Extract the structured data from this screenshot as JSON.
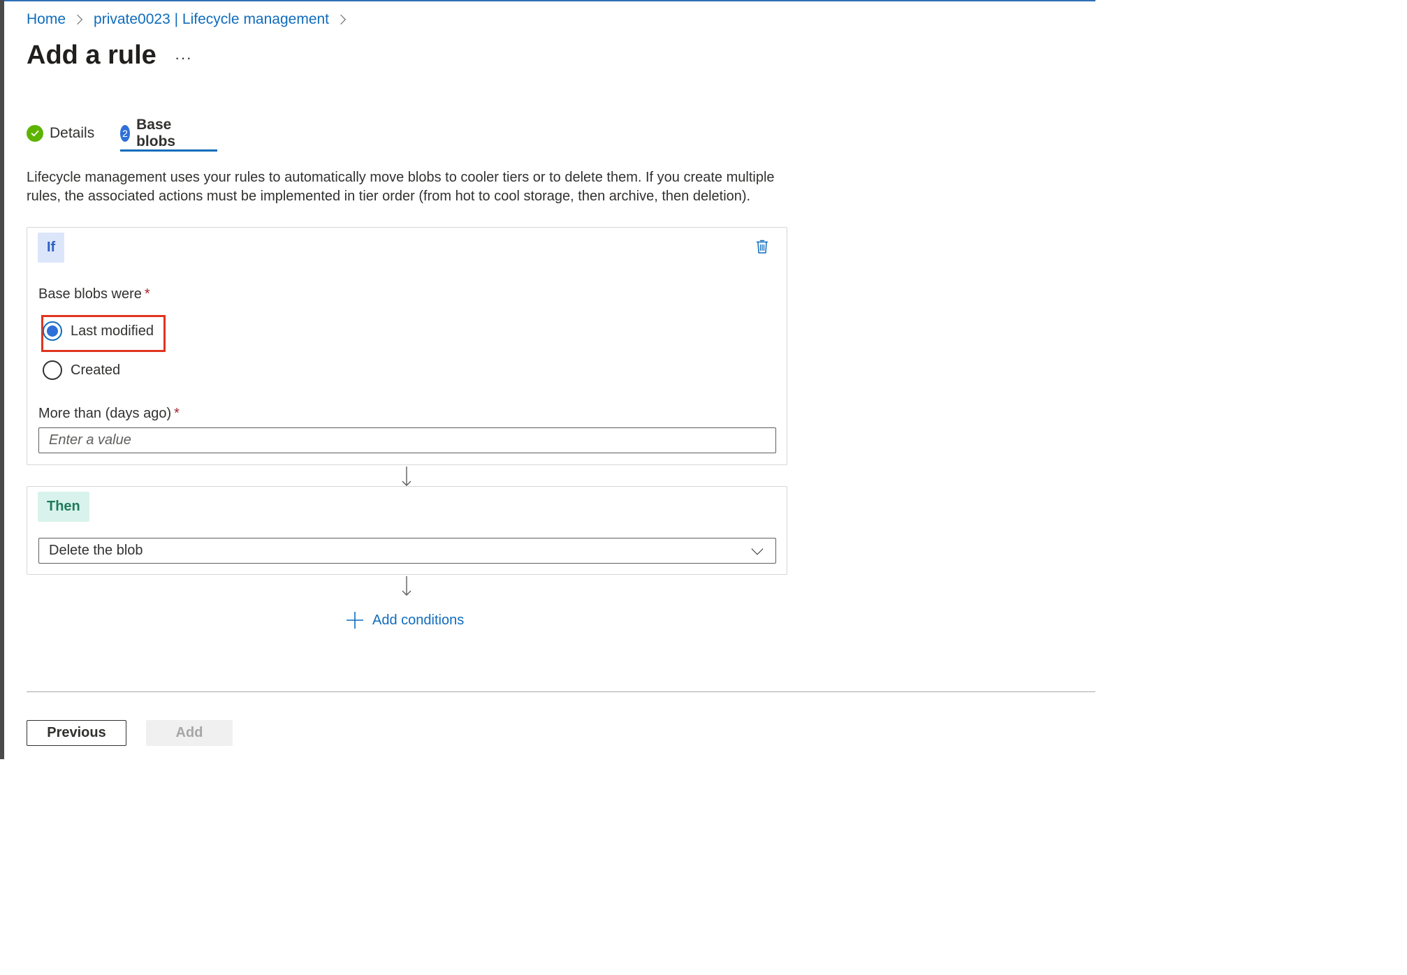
{
  "breadcrumb": {
    "home": "Home",
    "parent": "private0023 | Lifecycle management"
  },
  "page": {
    "title": "Add a rule",
    "more": "···"
  },
  "tabs": [
    {
      "label": "Details",
      "state": "completed",
      "badge": ""
    },
    {
      "label": "Base blobs",
      "state": "active",
      "badge": "2"
    }
  ],
  "description": "Lifecycle management uses your rules to automatically move blobs to cooler tiers or to delete them. If you create multiple rules, the associated actions must be implemented in tier order (from hot to cool storage, then archive, then deletion).",
  "if_block": {
    "pill": "If",
    "base_blobs_label": "Base blobs were",
    "required_mark": "*",
    "options": [
      {
        "label": "Last modified",
        "selected": true
      },
      {
        "label": "Created",
        "selected": false
      }
    ],
    "days_label": "More than (days ago)",
    "days_value": "",
    "days_placeholder": "Enter a value"
  },
  "then_block": {
    "pill": "Then",
    "action_selected": "Delete the blob"
  },
  "add_conditions": "Add conditions",
  "footer": {
    "previous": "Previous",
    "add": "Add"
  },
  "colors": {
    "link": "#0f6cbd",
    "check": "#5db300",
    "step_badge": "#2f6fd8",
    "highlight": "#e0341f",
    "if_pill_bg": "#dce6fb",
    "then_pill_bg": "#d9f3ec"
  }
}
